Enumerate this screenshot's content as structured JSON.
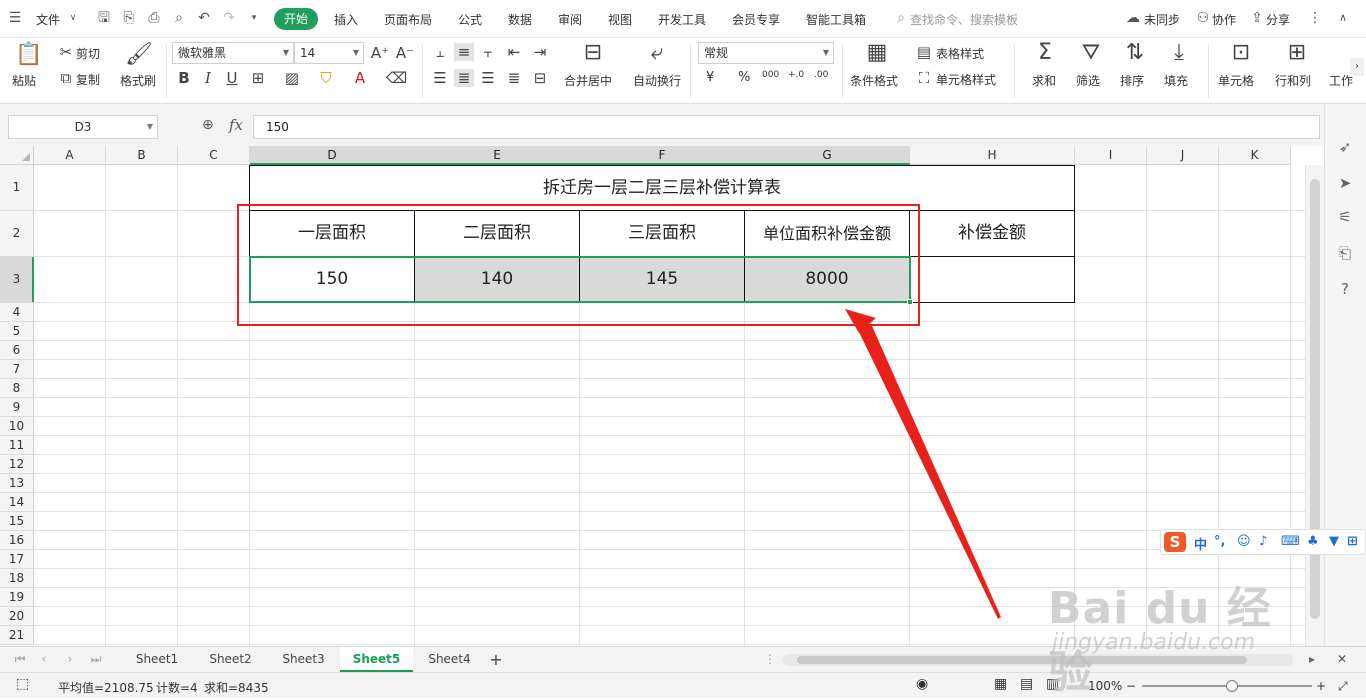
{
  "menubar": {
    "file_label": "文件",
    "tabs": [
      "开始",
      "插入",
      "页面布局",
      "公式",
      "数据",
      "审阅",
      "视图",
      "开发工具",
      "会员专享",
      "智能工具箱"
    ],
    "search_placeholder": "查找命令、搜索模板",
    "sync_label": "未同步",
    "collab_label": "协作",
    "share_label": "分享"
  },
  "ribbon": {
    "paste": "粘贴",
    "cut": "剪切",
    "copy": "复制",
    "format_painter": "格式刷",
    "font_name": "微软雅黑",
    "font_size": "14",
    "merge_center": "合并居中",
    "auto_wrap": "自动换行",
    "number_format": "常规",
    "currency_symbol": "¥",
    "percent_symbol": "%",
    "thousands_symbol": "000",
    "decimal_increase": "+.0",
    "decimal_decrease": ".00",
    "conditional_format": "条件格式",
    "table_style": "表格样式",
    "cell_style": "单元格样式",
    "sum": "求和",
    "filter": "筛选",
    "sort": "排序",
    "fill": "填充",
    "cell": "单元格",
    "row_col": "行和列",
    "worksheet": "工作"
  },
  "formula_bar": {
    "name_box": "D3",
    "fx_label": "fx",
    "value": "150"
  },
  "columns": [
    "A",
    "B",
    "C",
    "D",
    "E",
    "F",
    "G",
    "H",
    "I",
    "J",
    "K"
  ],
  "rows": [
    "1",
    "2",
    "3",
    "4",
    "5",
    "6",
    "7",
    "8",
    "9",
    "10",
    "11",
    "12",
    "13",
    "14",
    "15",
    "16",
    "17",
    "18",
    "19",
    "20",
    "21"
  ],
  "sheet": {
    "title": "拆迁房一层二层三层补偿计算表",
    "headers": [
      "一层面积",
      "二层面积",
      "三层面积",
      "单位面积补偿金额",
      "补偿金额"
    ],
    "values": [
      "150",
      "140",
      "145",
      "8000",
      ""
    ]
  },
  "sheet_tabs": [
    "Sheet1",
    "Sheet2",
    "Sheet3",
    "Sheet5",
    "Sheet4"
  ],
  "active_sheet": "Sheet5",
  "status": {
    "average": "平均值=2108.75",
    "count": "计数=4",
    "sum": "求和=8435",
    "zoom": "100%"
  },
  "ime": {
    "chinese": "中",
    "punct": "°,"
  },
  "watermark": {
    "main": "Bai du 经验",
    "sub": "jingyan.baidu.com"
  },
  "colors": {
    "accent_green": "#1e9f5b",
    "annotation_red": "#e8211b",
    "selected_fill": "#d9d9d9"
  }
}
